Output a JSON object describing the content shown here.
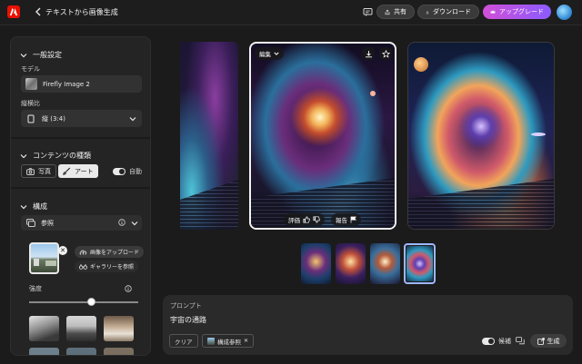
{
  "header": {
    "title": "テキストから画像生成",
    "share_label": "共有",
    "download_label": "ダウンロード",
    "upgrade_label": "アップグレード"
  },
  "panel": {
    "general": {
      "heading": "一般設定",
      "model_label": "モデル",
      "model_value": "Firefly Image 2",
      "aspect_label": "縦横比",
      "aspect_value": "縦 (3:4)"
    },
    "content_type": {
      "heading": "コンテンツの種類",
      "photo_label": "写真",
      "art_label": "アート",
      "auto_label": "自動",
      "auto_enabled": true,
      "selected": "アート"
    },
    "composition": {
      "heading": "構成",
      "reference_label": "参照",
      "upload_label": "画像をアップロード",
      "gallery_label": "ギャラリーを参照",
      "strength_label": "強度",
      "strength_value": 0.5
    }
  },
  "image_overlay": {
    "edit_label": "編集",
    "rate_label": "評価",
    "report_label": "報告"
  },
  "thumbnails": {
    "count": 4,
    "selected_index": 3
  },
  "prompt": {
    "label": "プロンプト",
    "text": "宇宙の通路",
    "clear_label": "クリア",
    "composition_ref_label": "構成参照",
    "candidates_label": "候補",
    "generate_label": "生成"
  },
  "colors": {
    "accent_logo": "#eb1000",
    "upgrade_start": "#d14fd6",
    "upgrade_end": "#8a5bff",
    "selected_thumb": "#9db8ff"
  }
}
